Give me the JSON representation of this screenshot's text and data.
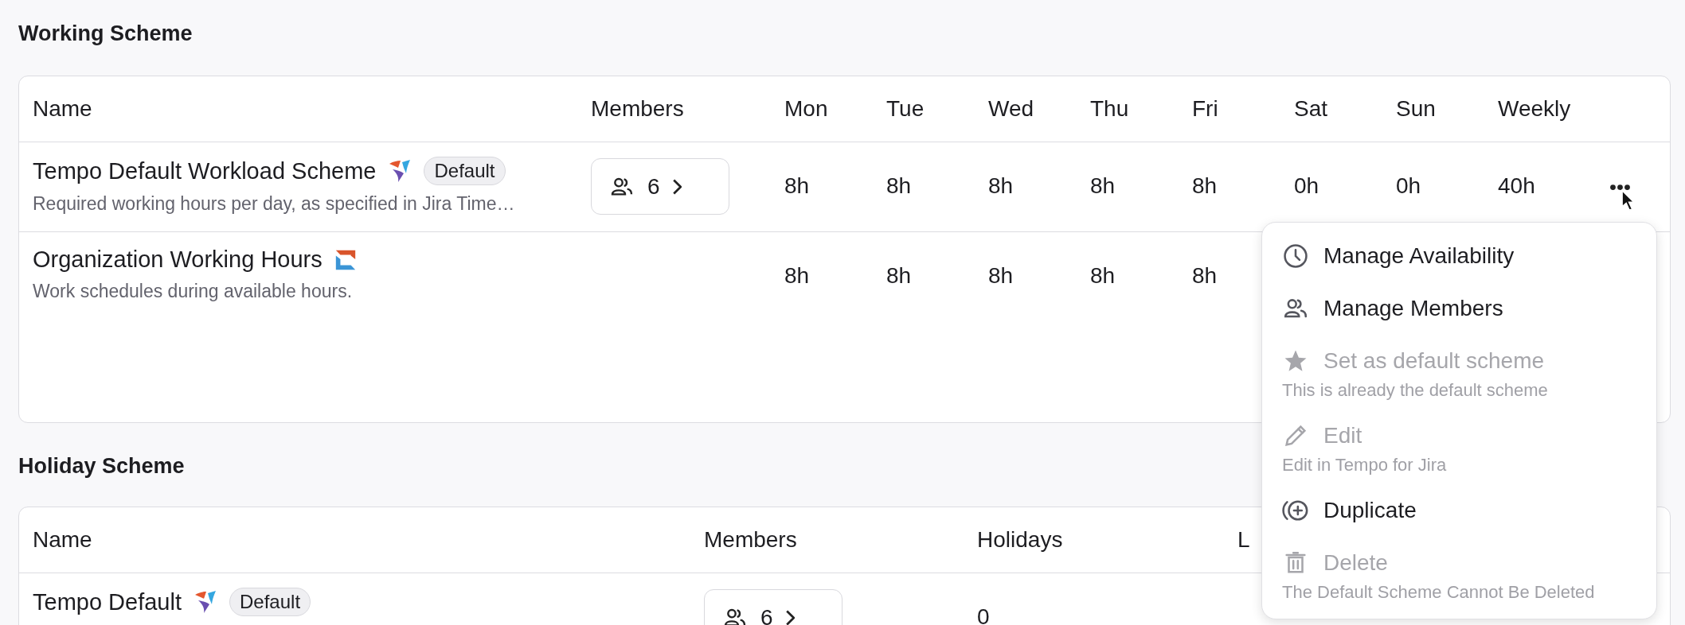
{
  "sections": [
    {
      "title": "Working Scheme",
      "kind": "working",
      "columns": [
        "Name",
        "Members",
        "Mon",
        "Tue",
        "Wed",
        "Thu",
        "Fri",
        "Sat",
        "Sun",
        "Weekly"
      ],
      "rows": [
        {
          "cells": [
            {
              "kind": "name",
              "name": "Tempo Default Workload Scheme",
              "badge": "Default",
              "description": "Required working hours per day, as specified in Jira Time…"
            },
            {
              "kind": "members",
              "value": "6"
            },
            "8h",
            "8h",
            "8h",
            "8h",
            "8h",
            "0h",
            "0h",
            "40h"
          ],
          "actions": true
        },
        {
          "cells": [
            {
              "kind": "name",
              "name": "Organization Working Hours",
              "description": "Work schedules during available hours."
            },
            "",
            "8h",
            "8h",
            "8h",
            "8h",
            "8h"
          ]
        }
      ]
    },
    {
      "title": "Holiday Scheme",
      "kind": "holiday",
      "columns": [
        "Name",
        "Members",
        "Holidays",
        "L"
      ],
      "rows": [
        {
          "cells": [
            {
              "kind": "name",
              "name": "Tempo Default",
              "badge": "Default"
            },
            {
              "kind": "members",
              "value": "6"
            },
            "0"
          ]
        }
      ]
    }
  ],
  "menu": {
    "items": [
      {
        "label": "Manage Availability",
        "disabled": false
      },
      {
        "label": "Manage Members",
        "disabled": false
      },
      {
        "label": "Set as default scheme",
        "disabled": true,
        "hint": "This is already the default scheme"
      },
      {
        "label": "Edit",
        "disabled": true,
        "hint": "Edit in Tempo for Jira"
      },
      {
        "label": "Duplicate",
        "disabled": false
      },
      {
        "label": "Delete",
        "disabled": true,
        "hint": "The Default Scheme Cannot Be Deleted"
      }
    ]
  }
}
